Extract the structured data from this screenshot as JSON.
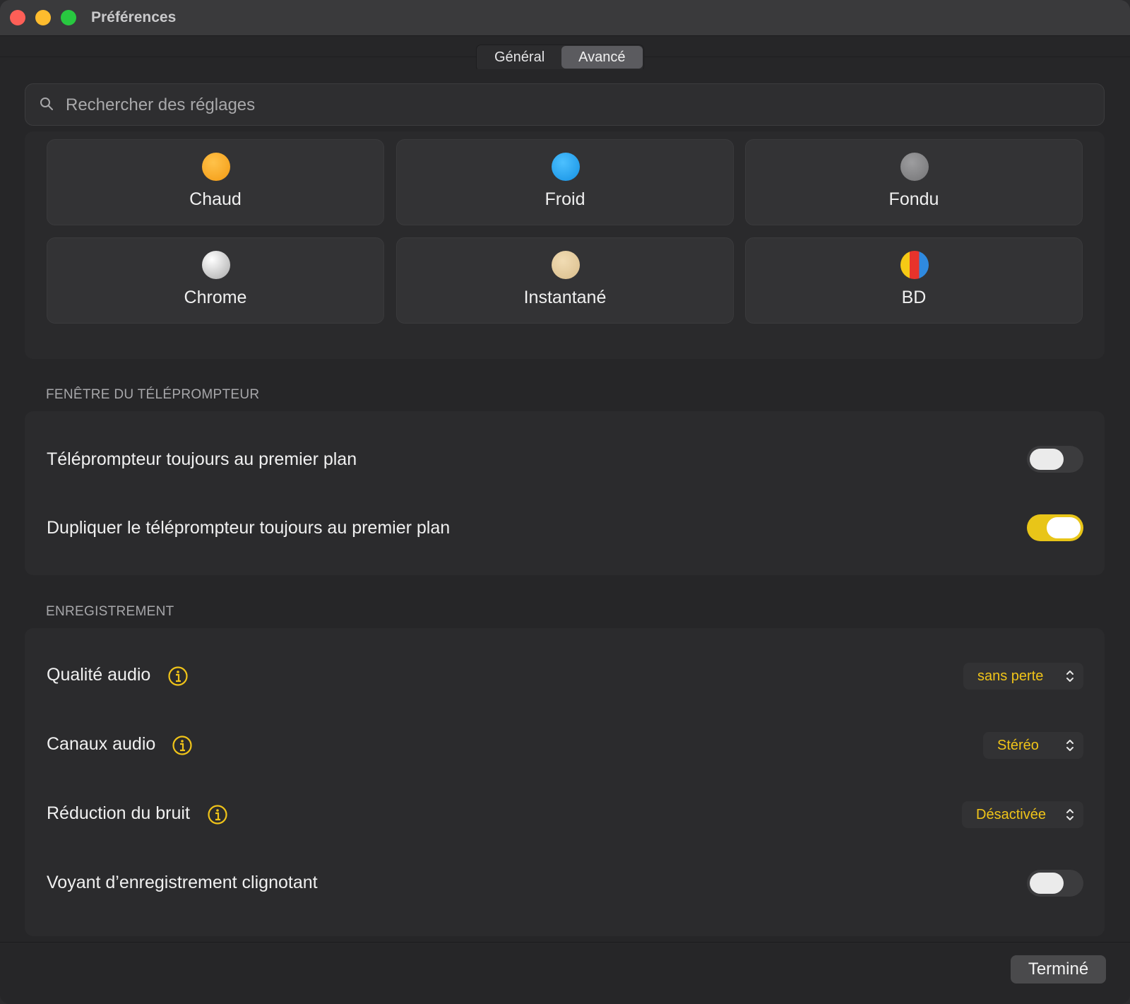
{
  "window": {
    "title": "Préférences"
  },
  "tabs": [
    {
      "label": "Général",
      "active": false
    },
    {
      "label": "Avancé",
      "active": true
    }
  ],
  "search": {
    "placeholder": "Rechercher des réglages",
    "value": ""
  },
  "themes": [
    {
      "label": "Chaud",
      "color": "#f9a61a"
    },
    {
      "label": "Froid",
      "color": "#1ea5f0"
    },
    {
      "label": "Fondu",
      "color": "#8b8b8b"
    },
    {
      "label": "Chrome",
      "color": "#d9d9d9"
    },
    {
      "label": "Instantané",
      "color": "#e6cfa3"
    },
    {
      "label": "BD",
      "colors": [
        "#f6c915",
        "#e8332b",
        "#2f8ae0"
      ]
    }
  ],
  "teleprompter": {
    "header": "FENÊTRE DU TÉLÉPROMPTEUR",
    "rows": [
      {
        "label": "Téléprompteur toujours au premier plan",
        "toggle": false
      },
      {
        "label": "Dupliquer le téléprompteur toujours au premier plan",
        "toggle": true
      }
    ]
  },
  "recording": {
    "header": "ENREGISTREMENT",
    "rows": [
      {
        "label": "Qualité audio",
        "info": true,
        "value": "sans perte"
      },
      {
        "label": "Canaux audio",
        "info": true,
        "value": "Stéréo"
      },
      {
        "label": "Réduction du bruit",
        "info": true,
        "value": "Désactivée"
      },
      {
        "label": "Voyant d’enregistrement clignotant",
        "toggle": false
      }
    ]
  },
  "footer": {
    "done_label": "Terminé"
  },
  "colors": {
    "accent": "#f0c419",
    "toggle_on": "#e8c518"
  }
}
